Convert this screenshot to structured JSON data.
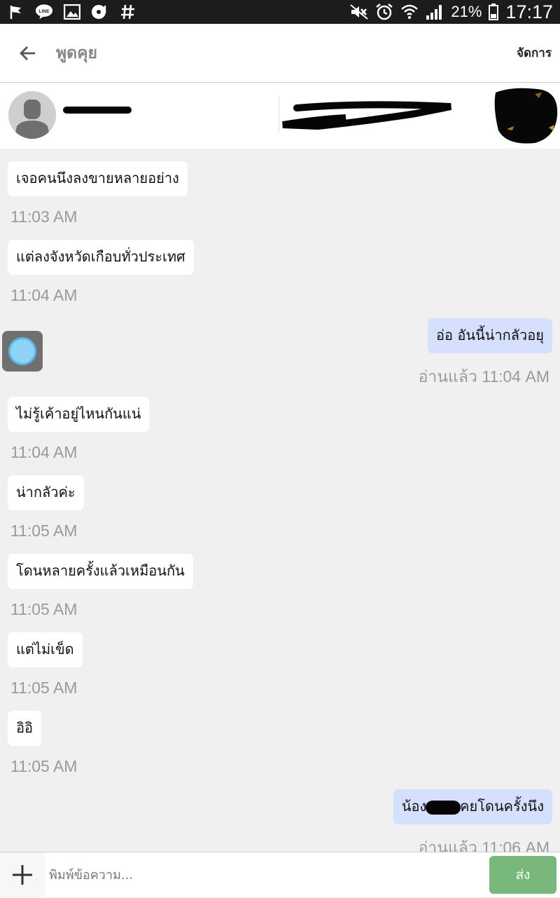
{
  "status_bar": {
    "battery": "21%",
    "time": "17:17",
    "left_icons": [
      "flag-icon",
      "line-app-icon",
      "gallery-icon",
      "music-icon",
      "hashtag-icon"
    ],
    "right_icons": [
      "mute-icon",
      "alarm-icon",
      "wifi-icon",
      "signal-icon",
      "battery-icon"
    ]
  },
  "header": {
    "title": "พูดคุย",
    "manage_label": "จัดการ"
  },
  "listing": {
    "seller_name": "",
    "item_title": ""
  },
  "messages": [
    {
      "direction": "in",
      "text": "เจอคนนึงลงขายหลายอย่าง",
      "time": "11:03 AM"
    },
    {
      "direction": "in",
      "text": "แต่ลงจังหวัดเกือบทั่วประเทศ",
      "time": "11:04 AM"
    },
    {
      "direction": "out",
      "text": "อ่อ  อันนี้น่ากลัวอยุ",
      "time": "อ่านแล้ว 11:04 AM"
    },
    {
      "direction": "in",
      "text": "ไม่รู้เค้าอยู่ไหนกันแน่",
      "time": "11:04 AM"
    },
    {
      "direction": "in",
      "text": "น่ากลัวค่ะ",
      "time": "11:05 AM"
    },
    {
      "direction": "in",
      "text": "โดนหลายครั้งแล้วเหมือนกัน",
      "time": "11:05 AM"
    },
    {
      "direction": "in",
      "text": "แต่ไม่เข็ด",
      "time": "11:05 AM"
    },
    {
      "direction": "in",
      "text": "อิอิ",
      "time": "11:05 AM"
    },
    {
      "direction": "out",
      "text": "น้องสาว      เคยโดนครั้งนึง",
      "time": "อ่านแล้ว 11:06 AM"
    }
  ],
  "composer": {
    "placeholder": "พิมพ์ข้อความ...",
    "send_label": "ส่ง"
  },
  "colors": {
    "incoming_bubble": "#ffffff",
    "outgoing_bubble": "#d5e0ff",
    "send_button": "#78b87a",
    "background": "#f0f0f0"
  }
}
